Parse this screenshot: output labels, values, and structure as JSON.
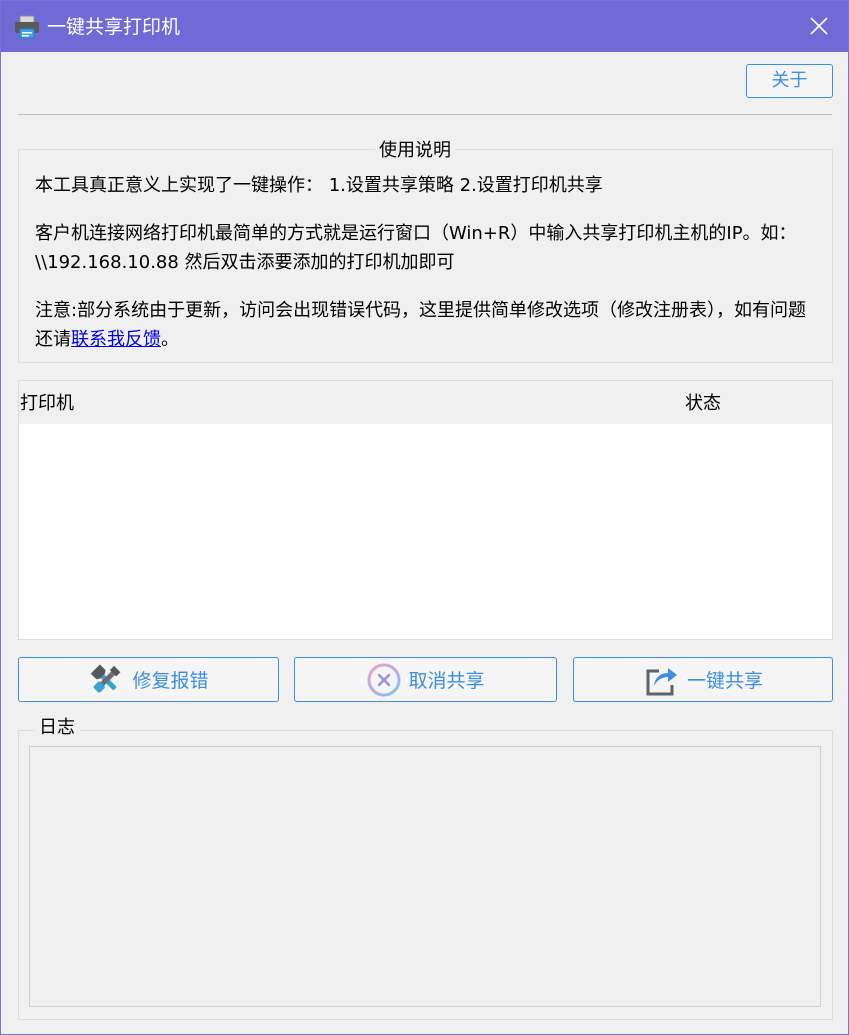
{
  "window": {
    "title": "一键共享打印机",
    "icons": {
      "app": "printer-icon",
      "close": "close-icon"
    },
    "colors": {
      "titlebar": "#6f6ad6",
      "accent": "#3d8de0",
      "link": "#0000ee"
    }
  },
  "toolbar": {
    "about_label": "关于"
  },
  "instructions": {
    "title": "使用说明",
    "line1": "本工具真正意义上实现了一键操作：  1.设置共享策略 2.设置打印机共享",
    "line2": "客户机连接网络打印机最简单的方式就是运行窗口（Win+R）中输入共享打印机主机的IP。如：\\\\192.168.10.88 然后双击添要添加的打印机加即可",
    "line3_prefix": "注意:部分系统由于更新，访问会出现错误代码，这里提供简单修改选项（修改注册表），如有问题还请",
    "line3_link": "联系我反馈",
    "line3_suffix": "。"
  },
  "printer_list": {
    "columns": [
      "打印机",
      "状态"
    ],
    "rows": []
  },
  "actions": {
    "repair_label": "修复报错",
    "repair_icon": "wrench-icon",
    "cancel_share_label": "取消共享",
    "cancel_share_icon": "cancel-circle-icon",
    "one_click_share_label": "一键共享",
    "one_click_share_icon": "share-arrow-icon"
  },
  "log": {
    "title": "日志",
    "content": ""
  }
}
